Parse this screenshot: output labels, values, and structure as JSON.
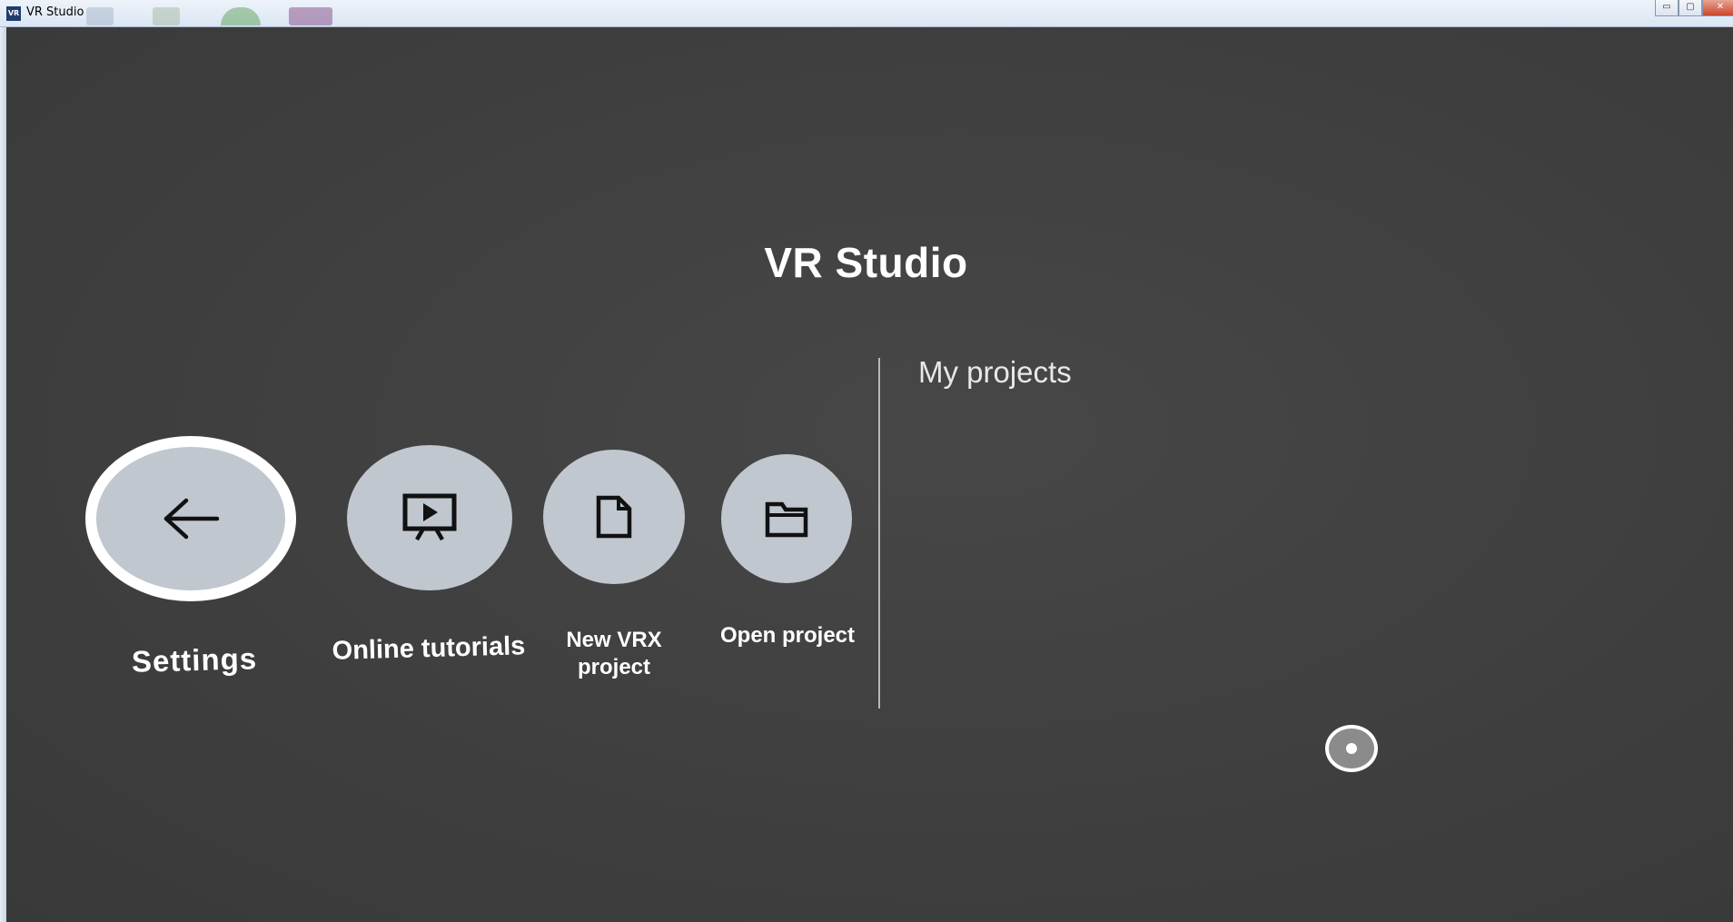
{
  "window": {
    "icon_text": "VR",
    "title": "VR Studio",
    "controls": {
      "minimize_glyph": "▭",
      "maximize_glyph": "▢",
      "close_glyph": "✕"
    }
  },
  "app": {
    "title": "VR Studio",
    "projects_heading": "My projects",
    "actions": [
      {
        "label": "Settings",
        "icon": "arrow-left-icon",
        "selected": true
      },
      {
        "label": "Online tutorials",
        "icon": "presentation-play-icon",
        "selected": false
      },
      {
        "label": "New VRX\nproject",
        "icon": "new-file-icon",
        "selected": false
      },
      {
        "label": "Open project",
        "icon": "folder-icon",
        "selected": false
      }
    ]
  },
  "colors": {
    "background": "#3f3f3f",
    "button_fill": "#c0c7cf",
    "selected_ring": "#ffffff",
    "text": "#ffffff",
    "icon": "#111111"
  }
}
